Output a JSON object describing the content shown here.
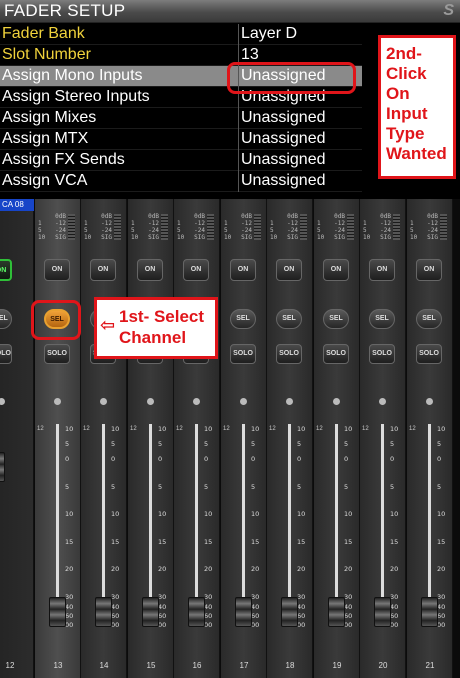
{
  "panel": {
    "title": "FADER SETUP",
    "rows": [
      {
        "label": "Fader Bank",
        "value": "Layer D"
      },
      {
        "label": "Slot Number",
        "value": "13"
      },
      {
        "label": "Assign Mono Inputs",
        "value": "Unassigned"
      },
      {
        "label": "Assign Stereo Inputs",
        "value": "Unassigned"
      },
      {
        "label": "Assign Mixes",
        "value": "Unassigned"
      },
      {
        "label": "Assign MTX",
        "value": "Unassigned"
      },
      {
        "label": "Assign FX Sends",
        "value": "Unassigned"
      },
      {
        "label": "Assign VCA",
        "value": "Unassigned"
      }
    ]
  },
  "annotations": {
    "step2": [
      "2nd-",
      "Click",
      "On",
      "Input",
      "Type",
      "Wanted"
    ],
    "step1": [
      "1st- Select",
      "Channel"
    ]
  },
  "mixer": {
    "layer_tag": "CA 08",
    "buttons": {
      "on": "ON",
      "sel": "SEL",
      "solo": "SOLO"
    },
    "meter_lines": [
      "0dB",
      "-12",
      "-24",
      "SIG"
    ],
    "meter_left": [
      "1",
      "5",
      "10"
    ],
    "scale": [
      "10",
      "5",
      "0",
      "5",
      "10",
      "15",
      "20",
      "30",
      "40",
      "60",
      "00"
    ],
    "scale_top": "12",
    "channels": [
      "12",
      "13",
      "14",
      "15",
      "16",
      "17",
      "18",
      "19",
      "20",
      "21"
    ]
  },
  "colors": {
    "annotation": "#e0151a",
    "fader_bank_label": "#f0d23c",
    "selected_on": "#2fbf38",
    "selected_sel": "#f0a238",
    "layer_blue": "#1745c8"
  }
}
